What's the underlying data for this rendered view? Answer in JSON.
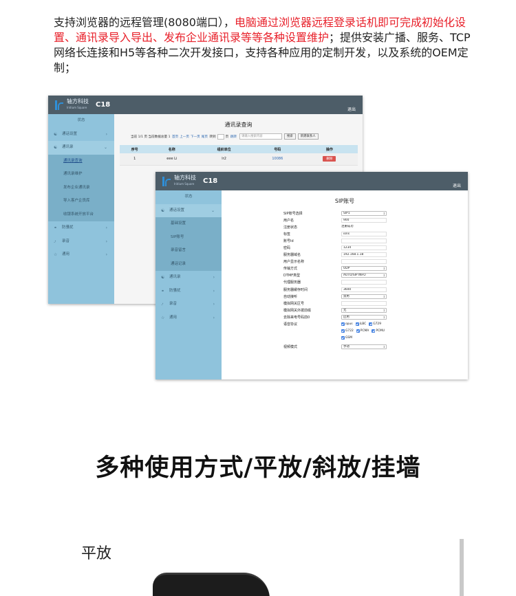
{
  "intro": {
    "part1": "支持浏览器的远程管理(8080端口），",
    "part2_red": "电脑通过浏览器远程登录话机即可完成初始化设置、通讯录导入导出、发布企业通讯录等等各种设置维护",
    "part3": "；提供安装广播、服务、TCP网络长连接和H5等各种二次开发接口，支持各种应用的定制开发，以及系统的OEM定制；"
  },
  "app": {
    "logo_cn": "轴方科技",
    "logo_en": "Iridium Square",
    "model": "C18",
    "logout": "退出"
  },
  "panel1": {
    "sidebar": {
      "status": "状态",
      "call_settings": "通话设置",
      "contacts": "通讯录",
      "sub": [
        "通讯录查询",
        "通讯录维护",
        "发布企业通讯录",
        "导入客户企员库",
        "收银系统开放平台"
      ],
      "anti_harass": "防骚扰",
      "recording": "录音",
      "general": "通用"
    },
    "title": "通讯录查询",
    "pager": {
      "text": "当前 1/1 页 当前数据总量 1",
      "first": "首页",
      "prev": "上一页",
      "next": "下一页",
      "last": "尾页",
      "goto": "转到",
      "page_unit": "页",
      "jump": "跳转",
      "search_placeholder": "请输入搜索内容",
      "search_btn": "搜索",
      "new_btn": "新建联系人"
    },
    "table": {
      "headers": [
        "序号",
        "名称",
        "组织单位",
        "号码",
        "操作"
      ],
      "rows": [
        {
          "no": "1",
          "name": "eee Li",
          "org": "lr2",
          "number": "10086",
          "action": "删除"
        }
      ]
    }
  },
  "panel2": {
    "sidebar": {
      "status": "状态",
      "call_settings": "通话设置",
      "sub": [
        "基础设置",
        "SIP账号",
        "录音留言",
        "通话记录"
      ],
      "contacts": "通讯录",
      "anti_harass": "防骚扰",
      "recording": "录音",
      "general": "通用"
    },
    "title": "SIP账号",
    "fields": [
      {
        "label": "SIP账号选择",
        "value": "SIP1",
        "kind": "select"
      },
      {
        "label": "用户名",
        "value": "900",
        "kind": "input"
      },
      {
        "label": "注册状态",
        "value": "注册成功",
        "kind": "plain"
      },
      {
        "label": "标签",
        "value": "ions",
        "kind": "input"
      },
      {
        "label": "账号Id",
        "value": "",
        "kind": "input"
      },
      {
        "label": "密码",
        "value": "1234",
        "kind": "input"
      },
      {
        "label": "服务器域名",
        "value": "192.168.1.18",
        "kind": "input"
      },
      {
        "label": "用户显示名称",
        "value": "",
        "kind": "input"
      },
      {
        "label": "传输方式",
        "value": "UDP",
        "kind": "select"
      },
      {
        "label": "DTMF类型",
        "value": "AUTO/SIP INFO",
        "kind": "select"
      },
      {
        "label": "代理服务器",
        "value": "",
        "kind": "input"
      },
      {
        "label": "服务器缓存时间",
        "value": "3600",
        "kind": "input"
      },
      {
        "label": "自动接听",
        "value": "禁用",
        "kind": "select"
      },
      {
        "label": "模拟网关区号",
        "value": "",
        "kind": "input"
      },
      {
        "label": "模拟网关外拨前缀",
        "value": "无",
        "kind": "select"
      },
      {
        "label": "去除来电号码前0",
        "value": "启用",
        "kind": "select"
      }
    ],
    "codec_label": "语音协议",
    "codecs_row1": [
      "opus",
      "iLBC",
      "G729"
    ],
    "codecs_row2": [
      "G722",
      "PCMA",
      "PCMU"
    ],
    "codecs_row3": [
      "GSM"
    ],
    "video_label": "视频模式",
    "video_value": "手动"
  },
  "headline": "多种使用方式/平放/斜放/挂墙",
  "sublabel": "平放"
}
